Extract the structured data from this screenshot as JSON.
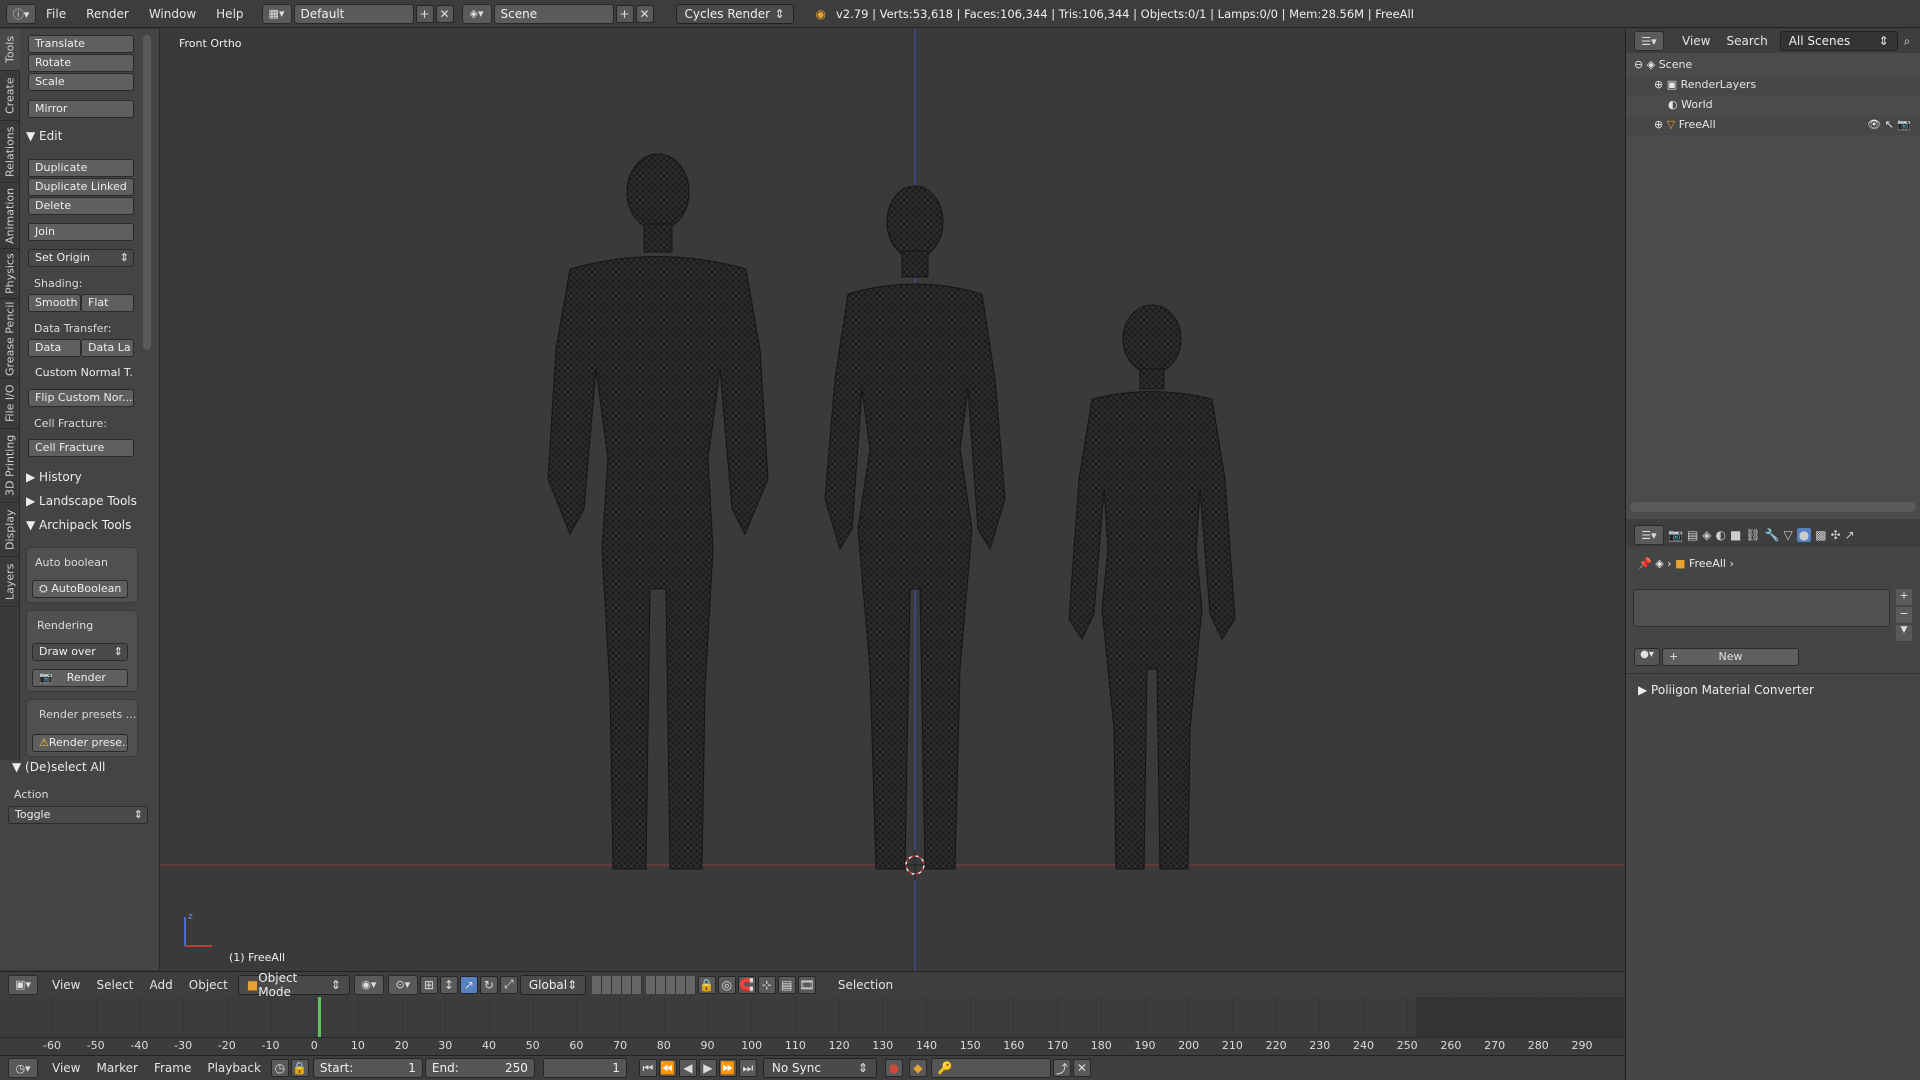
{
  "topbar": {
    "menus": [
      "File",
      "Render",
      "Window",
      "Help"
    ],
    "layout": "Default",
    "scene": "Scene",
    "engine": "Cycles Render",
    "stats": "v2.79 | Verts:53,618 | Faces:106,344 | Tris:106,344 | Objects:0/1 | Lamps:0/0 | Mem:28.56M | FreeAll"
  },
  "tabs": [
    "Tools",
    "Create",
    "Relations",
    "Animation",
    "Physics",
    "Grease Pencil",
    "File I/O",
    "3D Printing",
    "Display",
    "Layers"
  ],
  "toolshelf": {
    "transform": [
      "Translate",
      "Rotate",
      "Scale"
    ],
    "mirror": "Mirror",
    "edit_header": "Edit",
    "edit": [
      "Duplicate",
      "Duplicate Linked",
      "Delete"
    ],
    "join": "Join",
    "set_origin": "Set Origin",
    "shading_label": "Shading:",
    "smooth": "Smooth",
    "flat": "Flat",
    "data_transfer_label": "Data Transfer:",
    "data": "Data",
    "data_la": "Data La",
    "custom_normal": "Custom Normal T...",
    "flip_custom": "Flip Custom Nor...",
    "cell_fracture_label": "Cell Fracture:",
    "cell_fracture": "Cell Fracture",
    "history": "History",
    "landscape": "Landscape Tools",
    "archipack": "Archipack Tools",
    "auto_boolean_label": "Auto boolean",
    "auto_boolean_btn": "AutoBoolean",
    "rendering_label": "Rendering",
    "draw_over": "Draw over",
    "render_btn": "Render",
    "render_presets_label": "Render presets ...",
    "render_presets_btn": "Render prese..."
  },
  "operator": {
    "title": "(De)select All",
    "action_label": "Action",
    "action_value": "Toggle"
  },
  "viewport": {
    "view_name": "Front Ortho",
    "object_label": "(1) FreeAll"
  },
  "outliner": {
    "view": "View",
    "search": "Search",
    "scenes": "All Scenes",
    "items": [
      "Scene",
      "RenderLayers",
      "World",
      "FreeAll"
    ]
  },
  "properties": {
    "object": "FreeAll",
    "new_btn": "New",
    "converter": "Poliigon Material Converter"
  },
  "viewheader": {
    "menus": [
      "View",
      "Select",
      "Add",
      "Object"
    ],
    "mode": "Object Mode",
    "orientation": "Global",
    "selection": "Selection"
  },
  "timeline": {
    "ticks": [
      "-60",
      "-50",
      "-40",
      "-30",
      "-20",
      "-10",
      "0",
      "10",
      "20",
      "30",
      "40",
      "50",
      "60",
      "70",
      "80",
      "90",
      "100",
      "110",
      "120",
      "130",
      "140",
      "150",
      "160",
      "170",
      "180",
      "190",
      "200",
      "210",
      "220",
      "230",
      "240",
      "250",
      "260",
      "270",
      "280",
      "290"
    ],
    "menus": [
      "View",
      "Marker",
      "Frame",
      "Playback"
    ],
    "start_label": "Start:",
    "start": "1",
    "end_label": "End:",
    "end": "250",
    "current": "1",
    "sync": "No Sync"
  }
}
